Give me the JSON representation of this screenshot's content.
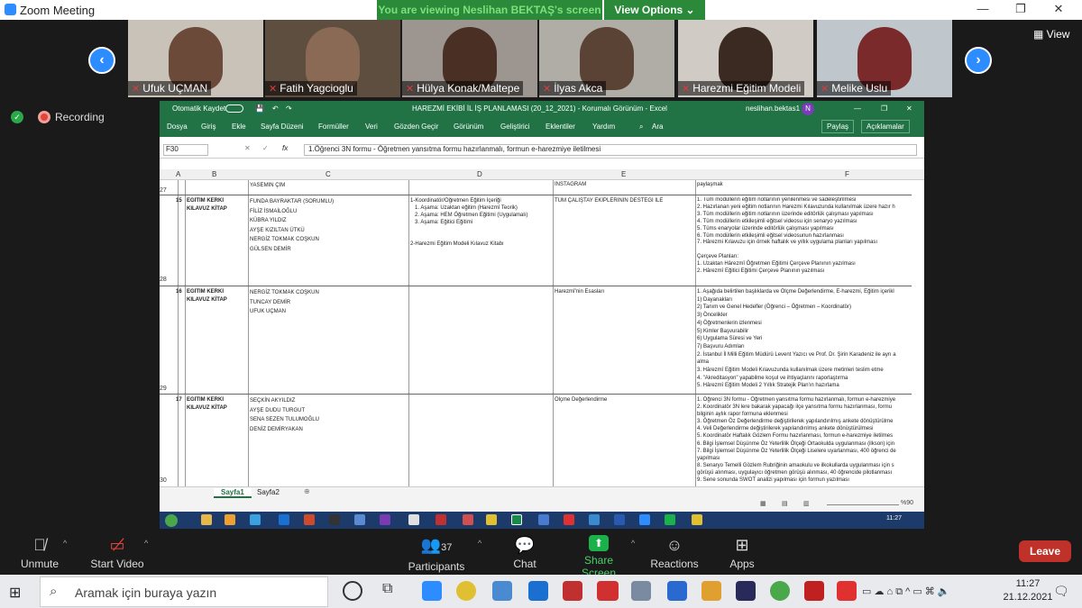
{
  "zoom": {
    "app_title": "Zoom Meeting",
    "banner": "You are viewing Neslihan BEKTAŞ's screen",
    "view_options": "View Options ⌄",
    "view_label": "View",
    "recording": "Recording",
    "participants": [
      {
        "name": "Ufuk UÇMAN"
      },
      {
        "name": "Fatih Yagcioglu"
      },
      {
        "name": "Hülya Konak/Maltepe"
      },
      {
        "name": "İlyas Akca"
      },
      {
        "name": "Harezmi Eğitim Modeli"
      },
      {
        "name": "Melike Uslu"
      }
    ],
    "controls": {
      "unmute": "Unmute",
      "start_video": "Start Video",
      "participants": "Participants",
      "participants_count": "37",
      "chat": "Chat",
      "share_screen": "Share Screen",
      "reactions": "Reactions",
      "apps": "Apps",
      "leave": "Leave"
    }
  },
  "excel": {
    "autosave": "Otomatik Kaydet",
    "doc_title": "HAREZMİ EKİBİ İL İŞ PLANLAMASI (20_12_2021)  -  Korumalı Görünüm  -  Excel",
    "user": "neslihan.bektas1",
    "user_initial": "N",
    "menu": [
      "Dosya",
      "Giriş",
      "Ekle",
      "Sayfa Düzeni",
      "Formüller",
      "Veri",
      "Gözden Geçir",
      "Görünüm",
      "Geliştirici",
      "Eklentiler",
      "Yardım",
      "Ara"
    ],
    "share": "Paylaş",
    "comments": "Açıklamalar",
    "cell_ref": "F30",
    "formula": "1.Öğrenci 3N formu - Öğretmen yansıtma formu hazırlanmalı, formun e-harezmiye iletilmesi",
    "columns": [
      "A",
      "B",
      "C",
      "D",
      "E",
      "F"
    ],
    "header_row": {
      "num": "27",
      "c": "YASEMİN ÇİM",
      "e": "İNSTAGRAM",
      "f": "paylaşmak"
    },
    "rows": [
      {
        "num": "28",
        "a": "15",
        "b": "EĞİTİM KERKİ\nKILAVUZ KİTAP",
        "c": "FUNDA BAYRAKTAR (SORUMLU)\nFİLİZ İSMAİLOĞLU\nKÜBRA YILDIZ\nAYŞE KIZILTAN ÜTKÜ\nNERGİZ TOKMAK COŞKUN\nGÜLSEN DEMİR",
        "d": "1-Koordinatör/Öğretmen Eğitim İçeriği\n   1. Aşama: Uzaktan eğitim (Harezmî Teorik)\n   2. Aşama: HEM Öğretmen Eğitimi (Uygulamalı)\n   3. Aşama: Eğitici Eğitimi\n\n\n2-Harezmi Eğitim Modeli Kılavuz Kitabı",
        "e": "TÜM ÇALIŞTAY EKİPLERİNİN DESTEĞİ İLE",
        "f": "1. Tüm modüllerin eğitim notlarının yenilenmesi ve sadeleştirilmesi\n2. Hazırlanan yeni eğitim notlarının Harezmi Kılavuzunda kullanılmak üzere hazır h\n3. Tüm modüllerin eğitim notlarının üzerinde editörlük çalışması yapılması\n4. Tüm modüllerin etkileşimli eğitsel videosu için senaryo yazılması\n5. Tüms enaryolar üzerinde editörlük çalışması yapılması\n6. Tüm modüllerin etkileşimli eğitsel videosunun hazırlanması\n7. Hârezmi Kılavuzu için örnek haftalık ve yıllık uygulama planları yapılması\n\nÇerçeve Planları:\n1. Uzaktan Hârezmî Öğretmen Eğitimi Çerçeve Planının yazılması\n2. Hârezmî Eğitici Eğitimi Çerçeve Planının yazılması"
      },
      {
        "num": "29",
        "a": "16",
        "b": "EĞİTİM KERKİ\nKILAVUZ KİTAP",
        "c": "NERGİZ TOKMAK COŞKUN\nTUNCAY DEMİR\nUFUK UÇMAN",
        "d": "",
        "e": "Harezmî'nin Esasları",
        "f": "1. Aşağıda belirtilen başlıklarda ve Ölçme Değerlendirme, E-harezmi, Eğitim içerikl\n1) Dayanakları\n2) Tanım ve Genel Hedefler (Öğrenci – Öğretmen – Koordinatör)\n3) Öncelikler\n4) Öğretmenlerin izlenmesi\n5) Kimler Başvurabilir\n6) Uygulama Süresi ve Yeri\n7) Başvuru Adımları\n2. İstanbul İl Milli Eğitim Müdürü Levent Yazıcı ve Prof. Dr. Şirin Karadeniz ile ayrı a\nalma\n3. Hârezmî Eğitim Modeli Kılavuzunda kullanılmak üzere metinleri teslim etme\n4. \"Akreditasyon\" yapabilme koşul ve ihtiyaçlarını raporlaştırma\n5. Hârezmî Eğitim Modeli 2 Yıllık Stratejik Plan'ın hazırlama"
      },
      {
        "num": "30",
        "a": "17",
        "b": "EĞİTİM KERKİ\nKILAVUZ KİTAP",
        "c": "SEÇKİN AKYILDIZ\nAYŞE DUDU TURGUT\nSENA SEZEN TULUMOĞLU\nDENİZ DEMİRYAKAN",
        "d": "",
        "e": "Ölçme Değerlendirme",
        "f": "1. Öğrenci 3N formu - Öğretmen yansıtma formu hazırlanmalı, formun e-harezmiye\n2. Koordinatör 3N lere bakarak yapacağı ilçe yansıtma formu hazırlanması, formu\nbilginin aylık rapor formuna eklenmesi\n3. Öğretmen Öz Değerlendirme değiştirilerek yapılandırılmış ankete dönüştürülme\n4. Veli Değerlendirme değiştirilerek yapılandırılmış ankete dönüştürülmesi\n5. Koordinatör Haftalık Gözlem Formu hazırlanması, formun e-harezmiye iletilmes\n6. Bilgi İşlemsel Düşünme Öz Yeterlilik Ölçeği Ortaokulda uygulanması (ilkson) için\n7. Bilgi İşlemsel Düşünme Öz Yeterlilik Ölçeği Liselere uyarlanması, 400 öğrenci de\nyapılması\n8. Senaryo Temelli Gözlem Rubriğinin amaokulu ve ilkokullarda uygulanması için s\ngörüşü alınması, uygulayıcı öğretmen görüşü alınması, 40 öğrencide pilotlanması\n9. Sene sonunda SWOT analizi yapılması için formun yazılması"
      }
    ],
    "sheets": [
      "Sayfa1",
      "Sayfa2"
    ],
    "zoom_level": "%90",
    "clock_small": "11:27"
  },
  "windows": {
    "search_placeholder": "Aramak için buraya yazın",
    "time": "11:27",
    "date": "21.12.2021"
  },
  "colors": {
    "zoom_green": "#2a8a3a",
    "excel_green": "#217346",
    "zoom_blue": "#2d8cff",
    "leave_red": "#c0312a"
  }
}
